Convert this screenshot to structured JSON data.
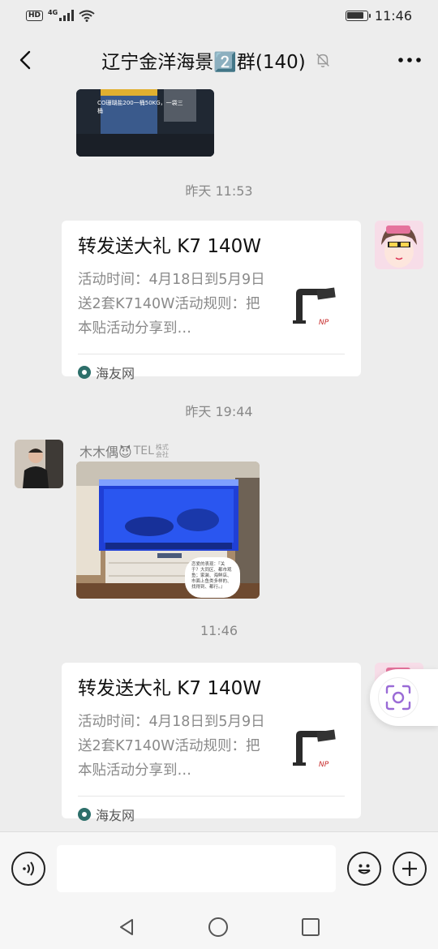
{
  "status_bar": {
    "hd": "HD",
    "network": "4G",
    "time": "11:46"
  },
  "header": {
    "title": "辽宁金洋海景2️⃣群(140)"
  },
  "messages": {
    "top_image_caption": "CO珊瑚盐200一桶50KG，一袋三桶",
    "ts1": "昨天 11:53",
    "card1": {
      "title": "转发送大礼 K7 140W",
      "desc": "活动时间：4月18日到5月9日送2套K7140W活动规则：把本贴活动分享到…",
      "source": "海友网"
    },
    "ts2": "昨天 19:44",
    "sender": {
      "name": "木木偶😈",
      "suffix_small": "株式会社",
      "suffix_tel": "TEL"
    },
    "tank_image_caption": "恋爱的表现：『关于？大同区、都市观鱼；家装、海鲜店、市面上鱼类多样的、找得到、都行。』",
    "ts3": "11:46",
    "card2": {
      "title": "转发送大礼 K7 140W",
      "desc": "活动时间：4月18日到5月9日送2套K7140W活动规则：把本贴活动分享到…",
      "source": "海友网"
    }
  },
  "input": {
    "placeholder": ""
  },
  "icons": {
    "back": "back-arrow-icon",
    "mute": "bell-off-icon",
    "more": "more-dots-icon",
    "voice": "voice-icon",
    "emoji": "emoji-icon",
    "plus": "plus-icon",
    "scan": "camera-scan-icon",
    "nav_back": "nav-back-icon",
    "nav_home": "nav-home-icon",
    "nav_recent": "nav-recent-icon"
  },
  "colors": {
    "background": "#ededed",
    "card": "#ffffff",
    "timestamp": "#888888",
    "accent_purple": "#9a6bd6"
  }
}
